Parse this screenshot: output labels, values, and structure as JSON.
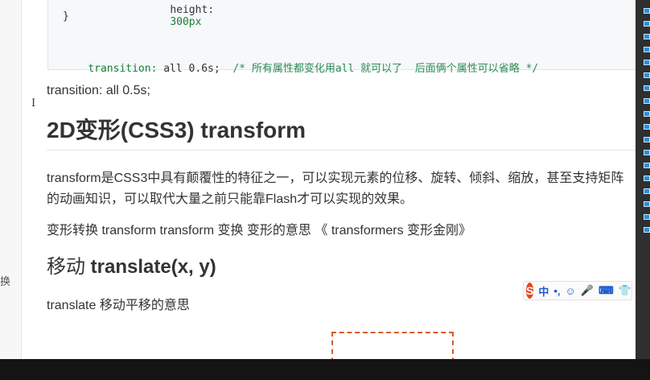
{
  "code_block": {
    "line1_prop": "height:",
    "line1_value": "300px",
    "closing_brace": "}",
    "transition_prop": "transition:",
    "transition_value": " all 0.6s;",
    "transition_comment": "  /* 所有属性都变化用all 就可以了  后面俩个属性可以省略 */"
  },
  "gutter_text": "换",
  "cursor_glyph": "I",
  "para_transition": "transition: all 0.5s;",
  "heading_2d": "2D变形(CSS3) transform",
  "para_transform": {
    "line1": "transform是CSS3中具有颠覆性的特征之一，可以实现元素的位移、旋转、倾斜、缩放，甚至支持矩阵",
    "line2": "的动画知识，可以取代大量之前只能靠Flash才可以实现的效果。"
  },
  "para_meaning": "变形转换 transform    transform  变换 变形的意思            《 transformers 变形金刚》",
  "heading_translate": {
    "prefix": "移动 ",
    "bold": "translate(x, y)"
  },
  "para_translate": "translate 移动平移的意思",
  "ime_toolbar": {
    "logo": "S",
    "lang": "中",
    "punct": "•,",
    "emoji": "☺",
    "mic": "🎤",
    "keyboard": "⌨",
    "skin": "👕",
    "more": "⚙"
  },
  "colors": {
    "accent_orange": "#d95b2e",
    "code_green": "#1a7f37",
    "ime_blue": "#1f5bd1"
  }
}
